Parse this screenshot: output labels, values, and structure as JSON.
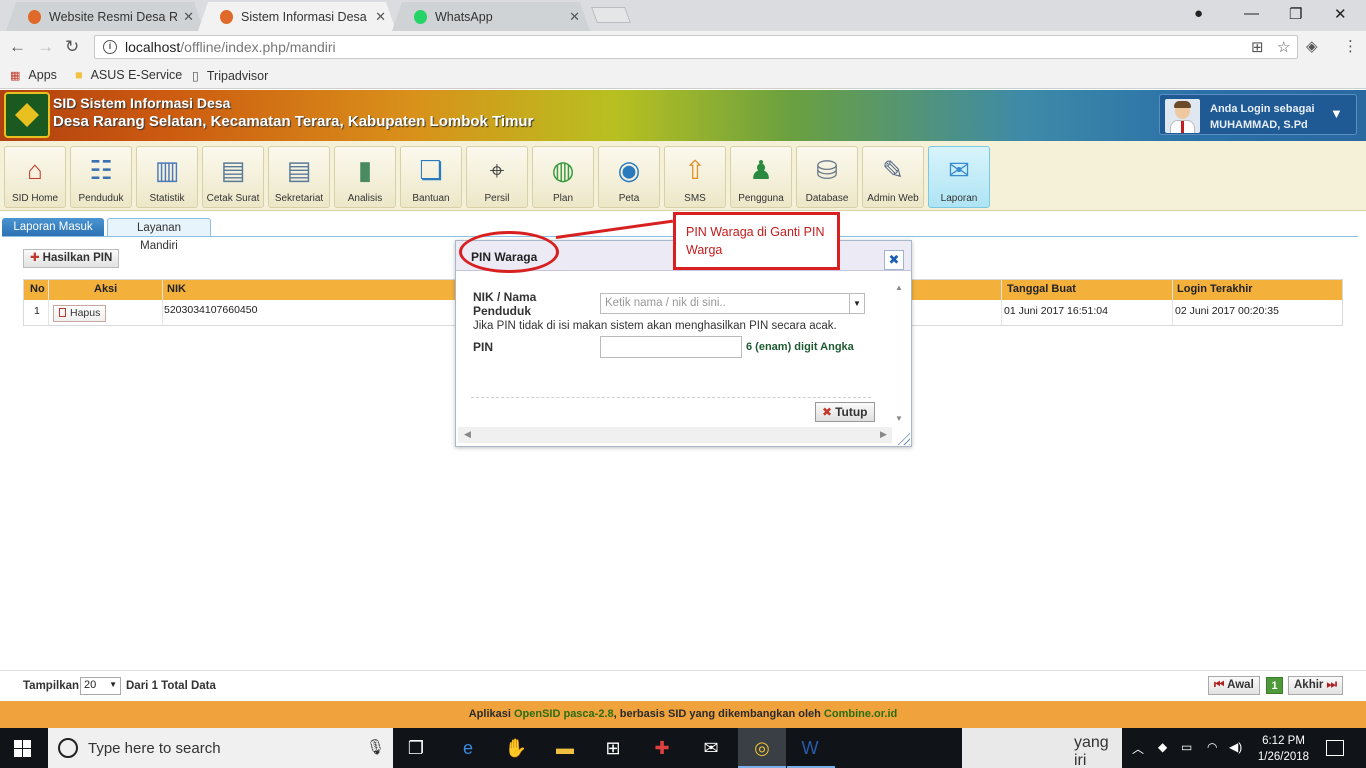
{
  "browser": {
    "tabs": [
      {
        "title": "Website Resmi Desa Rara",
        "favicon_color": "#e06a2a",
        "active": false
      },
      {
        "title": "Sistem Informasi Desa De",
        "favicon_color": "#e06a2a",
        "active": true
      },
      {
        "title": "WhatsApp",
        "favicon_color": "#25d366",
        "active": false
      }
    ],
    "url_host": "localhost",
    "url_path": "/offline/index.php/mandiri",
    "bookmarks": [
      "Apps",
      "ASUS E-Service",
      "Tripadvisor"
    ]
  },
  "header": {
    "app_title": "SID Sistem Informasi Desa",
    "village": "Desa Rarang Selatan, Kecamatan Terara, Kabupaten Lombok Timur",
    "login_label": "Anda Login sebagai",
    "user_name": "MUHAMMAD, S.Pd"
  },
  "modules": [
    {
      "label": "SID Home",
      "icon": "home-icon"
    },
    {
      "label": "Penduduk",
      "icon": "people-icon"
    },
    {
      "label": "Statistik",
      "icon": "chart-icon"
    },
    {
      "label": "Cetak Surat",
      "icon": "document-icon"
    },
    {
      "label": "Sekretariat",
      "icon": "document-icon"
    },
    {
      "label": "Analisis",
      "icon": "binder-icon"
    },
    {
      "label": "Bantuan",
      "icon": "book-icon"
    },
    {
      "label": "Persil",
      "icon": "map-pin-icon"
    },
    {
      "label": "Plan",
      "icon": "globe-search-icon"
    },
    {
      "label": "Peta",
      "icon": "globe-icon"
    },
    {
      "label": "SMS",
      "icon": "upload-icon"
    },
    {
      "label": "Pengguna",
      "icon": "users-icon"
    },
    {
      "label": "Database",
      "icon": "database-icon"
    },
    {
      "label": "Admin Web",
      "icon": "edit-icon"
    },
    {
      "label": "Laporan",
      "icon": "mail-icon",
      "active": true
    }
  ],
  "subtabs": [
    "Laporan Masuk",
    "Layanan Mandiri"
  ],
  "content": {
    "generate_pin_label": "Hasilkan PIN",
    "columns": [
      "No",
      "Aksi",
      "NIK",
      "Tanggal Buat",
      "Login Terakhir"
    ],
    "rows": [
      {
        "no": "1",
        "action": "Hapus",
        "nik": "5203034107660450",
        "created": "01 Juni 2017 16:51:04",
        "last_login": "02 Juni 2017 00:20:35"
      }
    ]
  },
  "dialog": {
    "title": "PIN Waraga",
    "nik_label": "NIK / Nama Penduduk",
    "nik_placeholder": "Ketik nama / nik di sini..",
    "note": "Jika PIN tidak di isi makan sistem akan menghasilkan PIN secara acak.",
    "pin_label": "PIN",
    "pin_help": "6 (enam) digit Angka",
    "close_label": "Tutup"
  },
  "annotation": {
    "text": "PIN Waraga di Ganti PIN Warga",
    "color": "#d82020"
  },
  "pagination": {
    "show_label": "Tampilkan",
    "per_page": "20",
    "total_label": "Dari 1 Total Data",
    "first_label": "Awal",
    "page": "1",
    "last_label": "Akhir"
  },
  "footer": {
    "prefix": "Aplikasi",
    "app_link": "OpenSID pasca-2.8",
    "middle": ", berbasis SID yang dikembangkan oleh",
    "org_link": "Combine.or.id"
  },
  "taskbar": {
    "search_placeholder": "Type here to search",
    "time": "6:12 PM",
    "date": "1/26/2018",
    "peek_text": "yang iri"
  }
}
